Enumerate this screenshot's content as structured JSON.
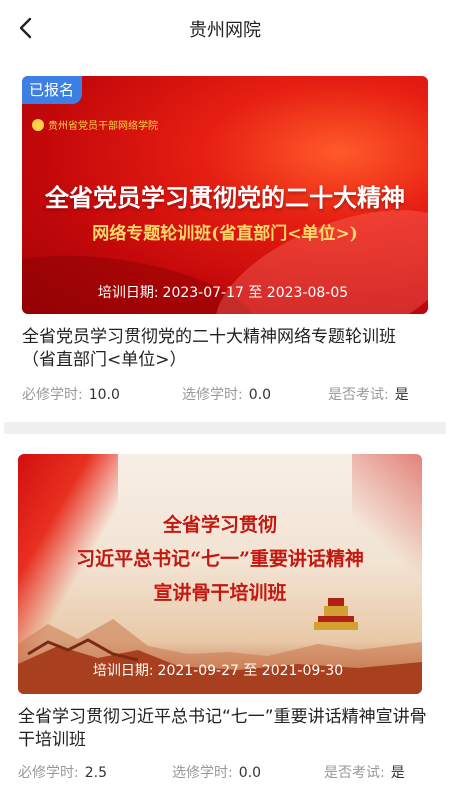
{
  "header": {
    "title": "贵州网院",
    "back_icon": "chevron-left-icon"
  },
  "courses": [
    {
      "badge": "已报名",
      "banner_org": "贵州省党员干部网络学院",
      "banner_title_line1": "全省党员学习贯彻党的二十大精神",
      "banner_title_line2": "网络专题轮训班(省直部门<单位>)",
      "date_label": "培训日期:",
      "date_range": "2023-07-17 至 2023-08-05",
      "title": "全省党员学习贯彻党的二十大精神网络专题轮训班（省直部门<单位>）",
      "required_label": "必修学时:",
      "required_value": "10.0",
      "elective_label": "选修学时:",
      "elective_value": "0.0",
      "exam_label": "是否考试:",
      "exam_value": "是"
    },
    {
      "banner_line1": "全省学习贯彻",
      "banner_line2": "习近平总书记“七一”重要讲话精神",
      "banner_line3": "宣讲骨干培训班",
      "date_label": "培训日期:",
      "date_range": "2021-09-27 至 2021-09-30",
      "title": "全省学习贯彻习近平总书记“七一”重要讲话精神宣讲骨干培训班",
      "required_label": "必修学时:",
      "required_value": "2.5",
      "elective_label": "选修学时:",
      "elective_value": "0.0",
      "exam_label": "是否考试:",
      "exam_value": "是"
    }
  ]
}
